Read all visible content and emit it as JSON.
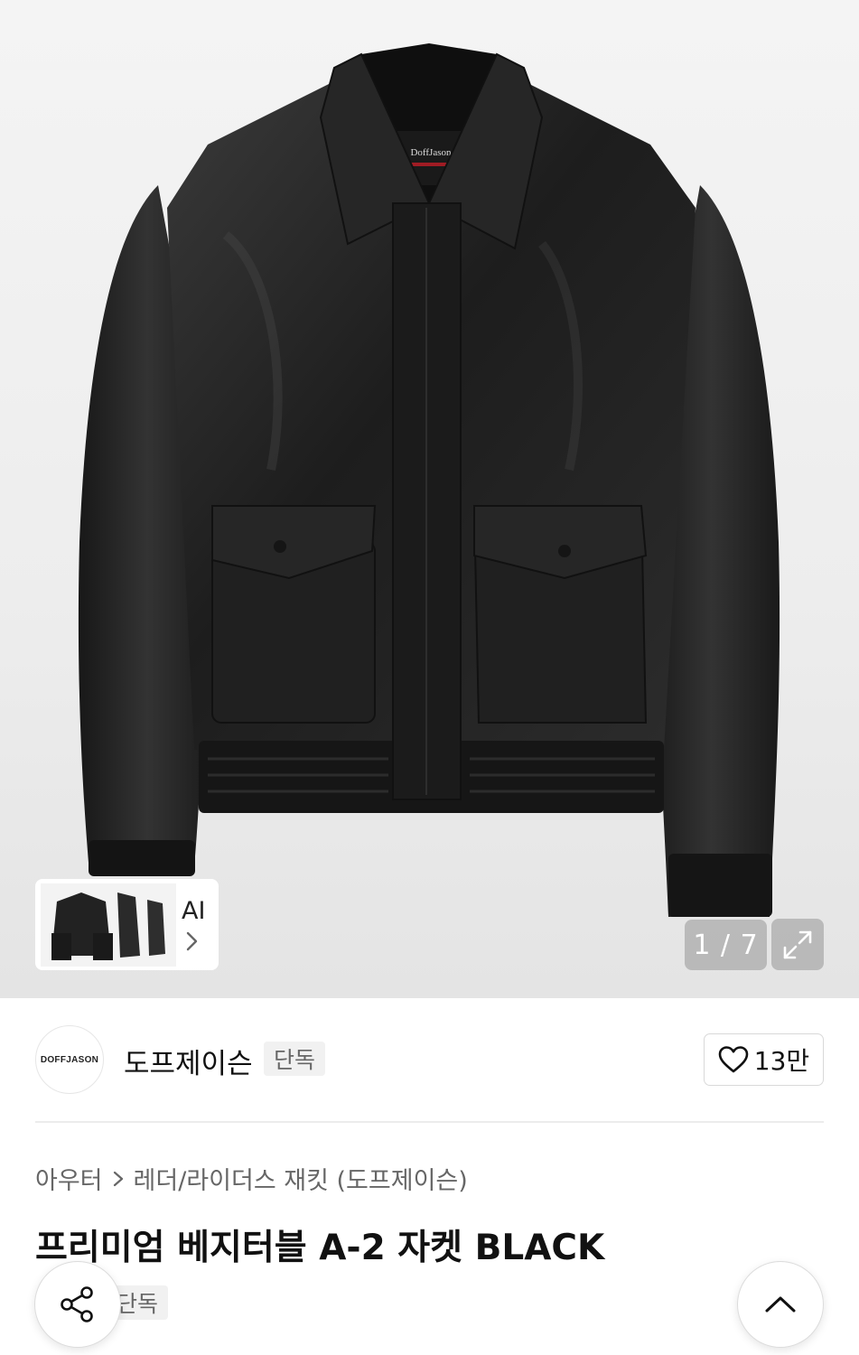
{
  "gallery": {
    "image_alt": "Black leather A-2 jacket",
    "label_brand": "DoffJason",
    "counter": "1 / 7",
    "ai_label": "AI",
    "icons": {
      "expand": "expand-icon",
      "ai_next": "chevron-right-icon"
    }
  },
  "brand": {
    "logo_text": "DOFFJASON",
    "name": "도프제이슨",
    "badge": "단독",
    "likes": "13만",
    "like_icon": "heart-icon"
  },
  "product": {
    "breadcrumb": [
      "아우터",
      "레더/라이더스 재킷 (도프제이슨)"
    ],
    "title": "프리미엄 베지터블 A-2 자켓 BLACK",
    "badge": "단독"
  },
  "floating": {
    "share_icon": "share-icon",
    "top_icon": "chevron-up-icon"
  }
}
